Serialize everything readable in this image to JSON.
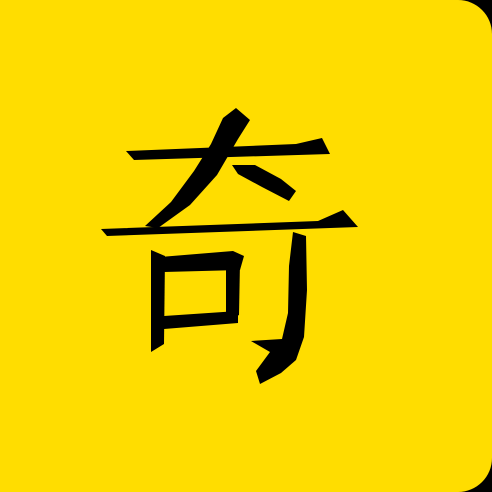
{
  "logo": {
    "character": "奇",
    "colors": {
      "background": "#FFDD00",
      "glyph": "#000000",
      "edge": "#000000"
    }
  }
}
